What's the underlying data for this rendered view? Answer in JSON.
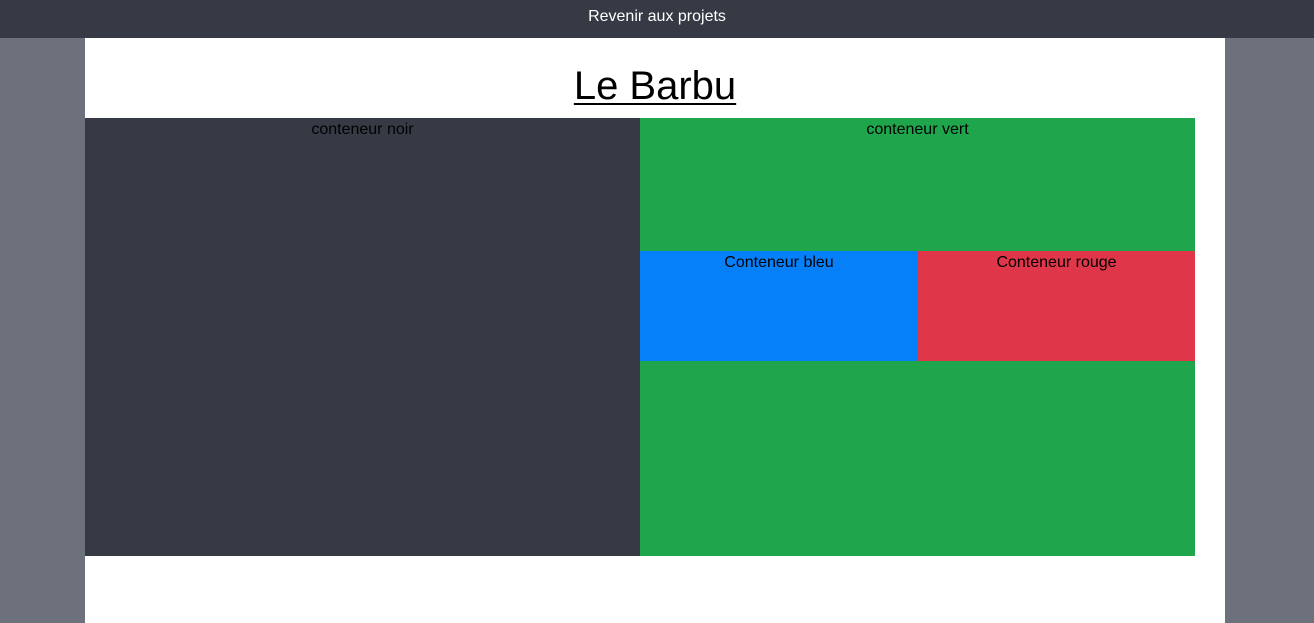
{
  "nav": {
    "back_link": "Revenir aux projets"
  },
  "page": {
    "title": "Le Barbu"
  },
  "containers": {
    "black": "conteneur noir",
    "green": "conteneur vert",
    "blue": "Conteneur bleu",
    "red": "Conteneur rouge"
  },
  "colors": {
    "topbar": "#353a44",
    "side_background": "#6c717b",
    "black_container": "#353a44",
    "green_container": "#1fa64c",
    "blue_container": "#0680f9",
    "red_container": "#e0364a"
  }
}
